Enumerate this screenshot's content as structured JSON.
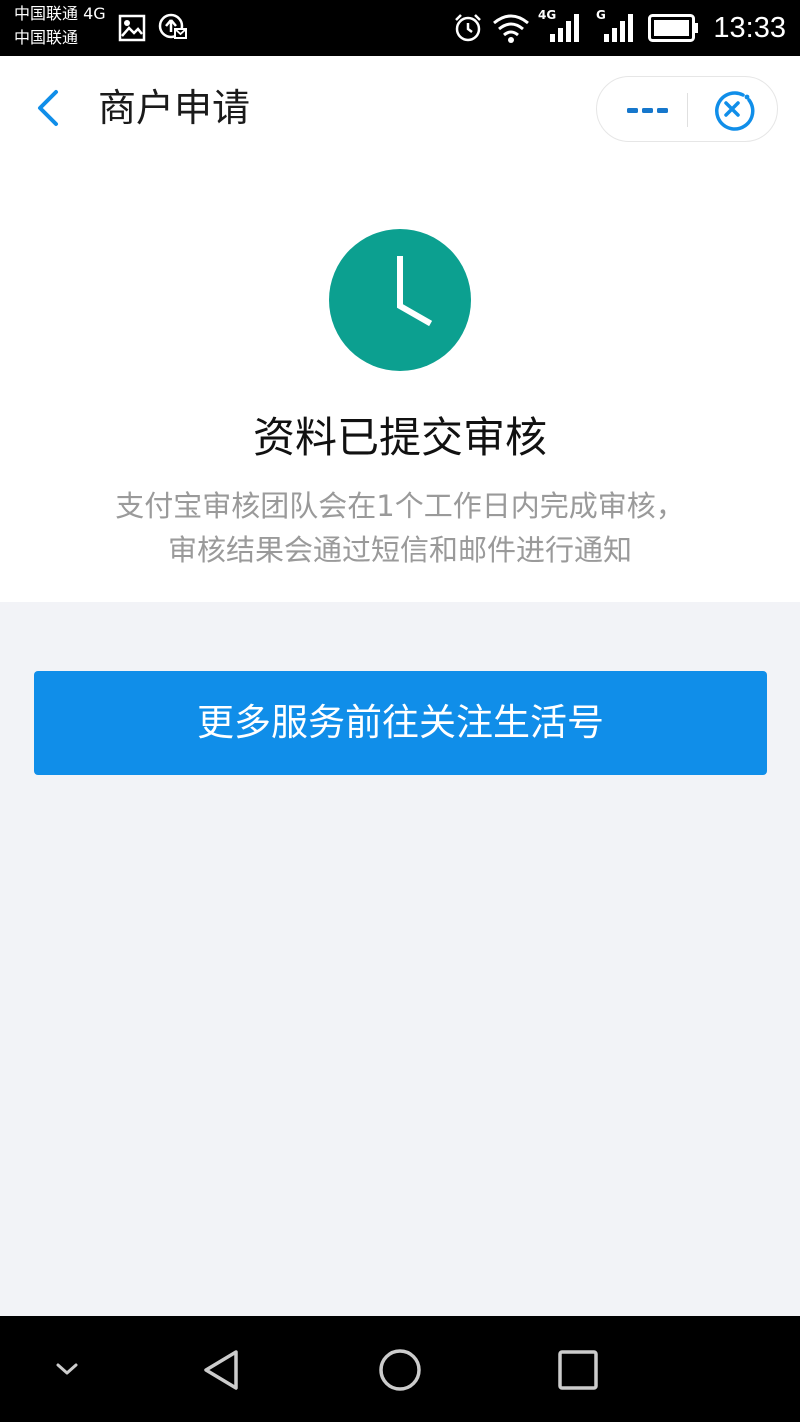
{
  "status_bar": {
    "carrier_1": "中国联通 4G",
    "carrier_2": "中国联通",
    "network_1": "4G",
    "network_2": "G",
    "time": "13:33",
    "icons": [
      "image-icon",
      "share-icon",
      "alarm-icon",
      "wifi-icon",
      "signal-icon",
      "battery-icon"
    ]
  },
  "header": {
    "title": "商户申请",
    "back_icon": "chevron-left-icon",
    "more_icon": "more-dots-icon",
    "close_icon": "close-circle-icon"
  },
  "result": {
    "icon": "clock-icon",
    "title": "资料已提交审核",
    "description": "支付宝审核团队会在1个工作日内完成审核，审核结果会通过短信和邮件进行通知"
  },
  "action": {
    "label": "更多服务前往关注生活号"
  },
  "nav_bar": {
    "icons": [
      "collapse-icon",
      "back-icon",
      "home-icon",
      "recents-icon"
    ]
  },
  "colors": {
    "accent": "#108ee9",
    "clock_bg": "#0ca090",
    "page_bg": "#f2f3f7"
  }
}
